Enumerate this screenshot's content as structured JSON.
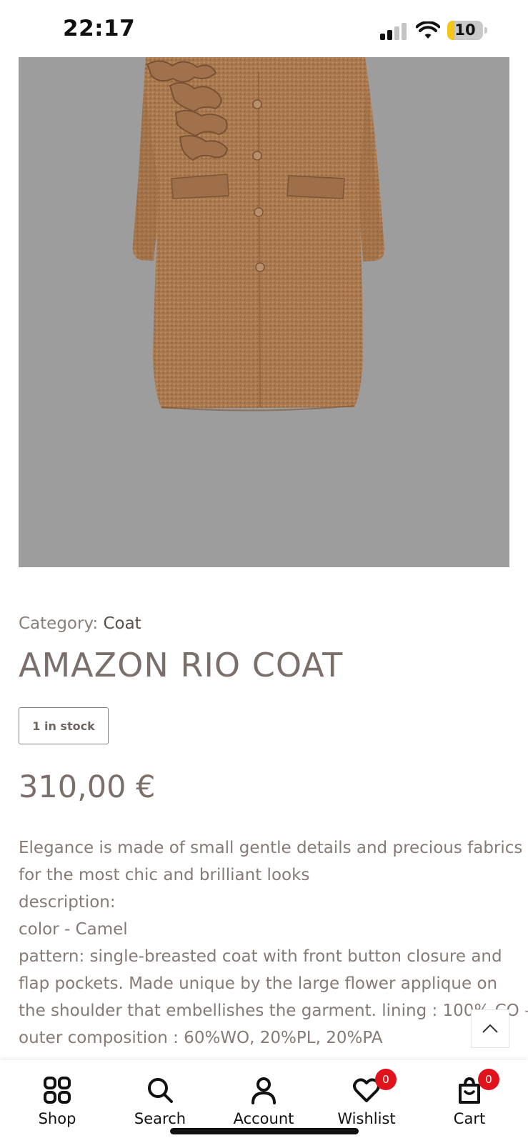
{
  "status_bar": {
    "time": "22:17",
    "battery": "10",
    "battery_level": 0.2,
    "signal_bars_active": 2
  },
  "product": {
    "category_label": "Category:",
    "category_value": "Coat",
    "title": "AMAZON RIO COAT",
    "stock": "1 in stock",
    "price": "310,00 €",
    "description_lines": [
      "Elegance is made of small gentle details and precious fabrics",
      "for the most chic and brilliant looks",
      "description:",
      "color - Camel",
      "pattern: single-breasted coat with front button closure and",
      "flap pockets. Made unique by the large flower applique on",
      "the shoulder that embellishes the garment. lining : 100% CO –",
      "outer composition : 60%WO, 20%PL, 20%PA"
    ]
  },
  "colors": {
    "image_bg": "#9d9d9d",
    "coat": "#a8774e",
    "badge": "#e0131d",
    "text": "#7a6f6a"
  },
  "bottom_nav": {
    "items": [
      {
        "label": "Shop",
        "icon": "grid-icon"
      },
      {
        "label": "Search",
        "icon": "search-icon"
      },
      {
        "label": "Account",
        "icon": "user-icon"
      },
      {
        "label": "Wishlist",
        "icon": "heart-icon",
        "badge": "0"
      },
      {
        "label": "Cart",
        "icon": "bag-icon",
        "badge": "0"
      }
    ]
  }
}
